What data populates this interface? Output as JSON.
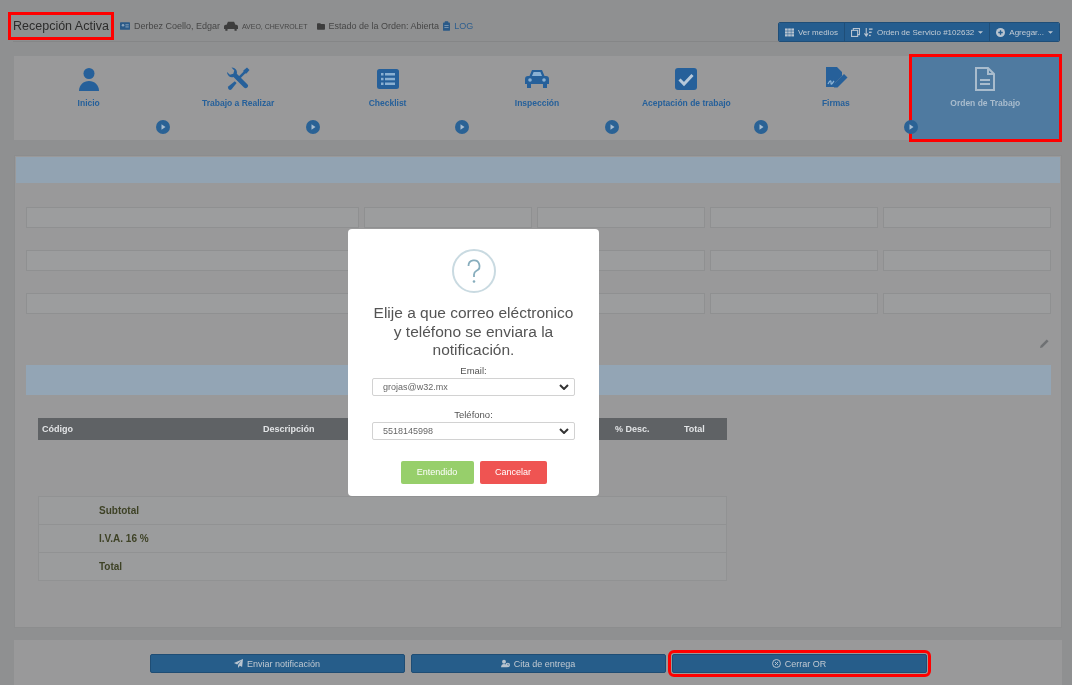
{
  "header": {
    "title": {
      "text": "Recepción Activa",
      "highlighted": true
    },
    "customer": "Derbez Coello, Edgar",
    "vehicle": "AVEO, CHEVROLET",
    "order_status": "Estado de la Orden: Abierta",
    "log_link": "LOG"
  },
  "toolbar": {
    "buttons": [
      {
        "label": "Ver medios",
        "kind": "plain"
      },
      {
        "label": "Orden de Servicio #102632",
        "kind": "dropdown"
      },
      {
        "label": "Agregar...",
        "kind": "dropdown"
      }
    ]
  },
  "steps": [
    {
      "label": "Inicio",
      "selected": false,
      "highlighted": false
    },
    {
      "label": "Trabajo a Realizar",
      "selected": false,
      "highlighted": false
    },
    {
      "label": "Checklist",
      "selected": false,
      "highlighted": false
    },
    {
      "label": "Inspección",
      "selected": false,
      "highlighted": false
    },
    {
      "label": "Aceptación de trabajo",
      "selected": false,
      "highlighted": false
    },
    {
      "label": "Firmas",
      "selected": false,
      "highlighted": false
    },
    {
      "label": "Orden de Trabajo",
      "selected": true,
      "highlighted": true
    }
  ],
  "parts_table": {
    "columns": [
      "Código",
      "Descripción",
      "% Desc.",
      "Total"
    ],
    "summary": [
      "Subtotal",
      "I.V.A. 16 %",
      "Total"
    ]
  },
  "modal": {
    "title": "Elije a que correo eléctronico y teléfono se enviara la notificación.",
    "fields": [
      {
        "label": "Email:",
        "value": "grojas@w32.mx"
      },
      {
        "label": "Teléfono:",
        "value": "5518145998"
      }
    ],
    "buttons": [
      {
        "label": "Entendido",
        "kind": "confirm"
      },
      {
        "label": "Cancelar",
        "kind": "cancel"
      }
    ]
  },
  "footer": {
    "buttons": [
      {
        "label": "Enviar notificación",
        "highlighted": false
      },
      {
        "label": "Cita de entrega",
        "highlighted": false
      },
      {
        "label": "Cerrar OR",
        "highlighted": true
      }
    ]
  }
}
